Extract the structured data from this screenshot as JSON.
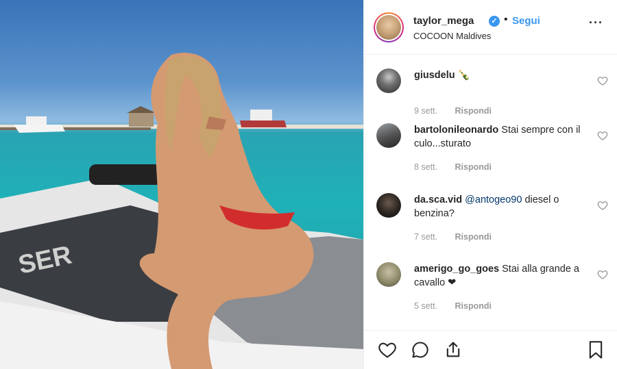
{
  "post": {
    "username": "taylor_mega",
    "follow_label": "Segui",
    "location": "COCOON Maldives",
    "separator": "•"
  },
  "comments": [
    {
      "user": "giusdelu",
      "text": "🍾",
      "mention": "",
      "time": "9 sett.",
      "reply": "Rispondi"
    },
    {
      "user": "bartolonileonardo",
      "text": "Stai sempre con il culo...sturato",
      "mention": "",
      "time": "8 sett.",
      "reply": "Rispondi"
    },
    {
      "user": "da.sca.vid",
      "mention": "@antogeo90",
      "text": "diesel o benzina?",
      "time": "7 sett.",
      "reply": "Rispondi"
    },
    {
      "user": "amerigo_go_goes",
      "text": "Stai alla grande a cavallo ❤",
      "mention": "",
      "time": "5 sett.",
      "reply": "Rispondi"
    }
  ],
  "icons": {
    "like": "heart-icon",
    "comment": "comment-icon",
    "share": "share-icon",
    "save": "bookmark-icon",
    "options": "more-options-icon",
    "verified": "verified-badge-icon"
  },
  "colors": {
    "accent": "#3897f0",
    "text": "#262626",
    "muted": "#999999"
  }
}
